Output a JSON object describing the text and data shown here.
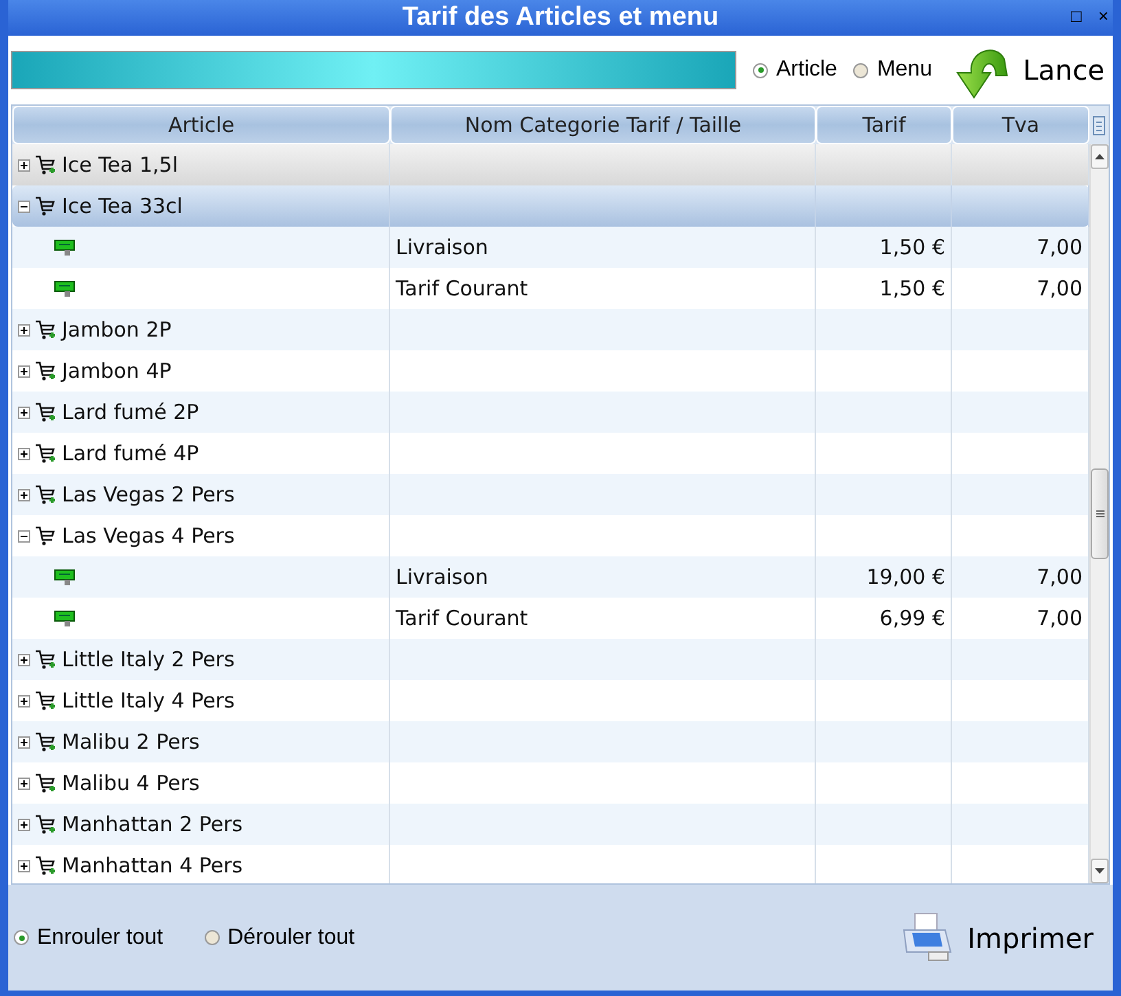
{
  "window": {
    "title": "Tarif des Articles et menu",
    "controls": [
      "□",
      "×"
    ]
  },
  "toolbar": {
    "progress": {
      "level": 1
    },
    "modes": [
      {
        "label": "Article",
        "selected": true
      },
      {
        "label": "Menu",
        "selected": false
      }
    ],
    "run_button": "Lance"
  },
  "table": {
    "columns": [
      "Article",
      "Nom Categorie Tarif / Taille",
      "Tarif",
      "Tva"
    ],
    "groups": [
      {
        "name": "Ice Tea 1,5l",
        "expanded": false,
        "selected": false,
        "focused": true
      },
      {
        "name": "Ice Tea 33cl",
        "expanded": true,
        "selected": true,
        "focused": false,
        "children": [
          {
            "category": "Livraison",
            "tarif": "1,50 €",
            "tva": "7,00"
          },
          {
            "category": "Tarif Courant",
            "tarif": "1,50 €",
            "tva": "7,00"
          }
        ]
      },
      {
        "name": "Jambon 2P",
        "expanded": false,
        "selected": false,
        "focused": false
      },
      {
        "name": "Jambon 4P",
        "expanded": false,
        "selected": false,
        "focused": false
      },
      {
        "name": "Lard fumé 2P",
        "expanded": false,
        "selected": false,
        "focused": false
      },
      {
        "name": "Lard fumé 4P",
        "expanded": false,
        "selected": false,
        "focused": false
      },
      {
        "name": "Las Vegas 2 Pers",
        "expanded": false,
        "selected": false,
        "focused": false
      },
      {
        "name": "Las Vegas 4 Pers",
        "expanded": true,
        "selected": false,
        "focused": false,
        "children": [
          {
            "category": "Livraison",
            "tarif": "19,00 €",
            "tva": "7,00"
          },
          {
            "category": "Tarif Courant",
            "tarif": "6,99 €",
            "tva": "7,00"
          }
        ]
      },
      {
        "name": "Little Italy 2 Pers",
        "expanded": false,
        "selected": false,
        "focused": false
      },
      {
        "name": "Little Italy 4 Pers",
        "expanded": false,
        "selected": false,
        "focused": false
      },
      {
        "name": "Malibu 2 Pers",
        "expanded": false,
        "selected": false,
        "focused": false
      },
      {
        "name": "Malibu 4 Pers",
        "expanded": false,
        "selected": false,
        "focused": false
      },
      {
        "name": "Manhattan 2 Pers",
        "expanded": false,
        "selected": false,
        "focused": false
      },
      {
        "name": "Manhattan 4 Pers",
        "expanded": false,
        "selected": false,
        "focused": false
      }
    ]
  },
  "footer": {
    "options": [
      {
        "label": "Enrouler tout",
        "selected": true
      },
      {
        "label": "Dérouler tout",
        "selected": false
      }
    ],
    "print_button": "Imprimer"
  }
}
